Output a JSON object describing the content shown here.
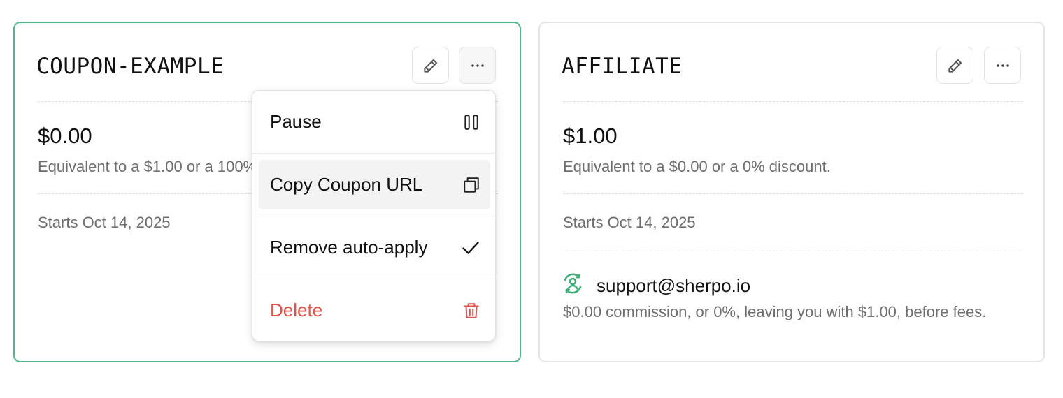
{
  "cards": [
    {
      "code": "COUPON-EXAMPLE",
      "amount": "$0.00",
      "equivalent": "Equivalent to a $1.00 or a 100% discount.",
      "starts": "Starts Oct 14, 2025",
      "selected": true
    },
    {
      "code": "AFFILIATE",
      "amount": "$1.00",
      "equivalent": "Equivalent to a $0.00 or a 0% discount.",
      "starts": "Starts Oct 14, 2025",
      "affiliate": {
        "email": "support@sherpo.io",
        "commission": "$0.00 commission, or 0%, leaving you with $1.00, before fees."
      }
    }
  ],
  "menu": {
    "items": [
      {
        "label": "Pause",
        "icon": "pause-icon"
      },
      {
        "label": "Copy Coupon URL",
        "icon": "copy-icon",
        "hovered": true
      },
      {
        "label": "Remove auto-apply",
        "icon": "check-icon"
      },
      {
        "label": "Delete",
        "icon": "trash-icon",
        "danger": true
      }
    ]
  },
  "icons": {
    "edit": "pencil-icon",
    "more": "ellipsis-icon",
    "affiliate": "affiliate-user-icon"
  },
  "colors": {
    "selected_border": "#4fb88a",
    "affiliate_icon": "#3fae79",
    "danger": "#e0534a",
    "muted_text": "#6e6e6e"
  }
}
